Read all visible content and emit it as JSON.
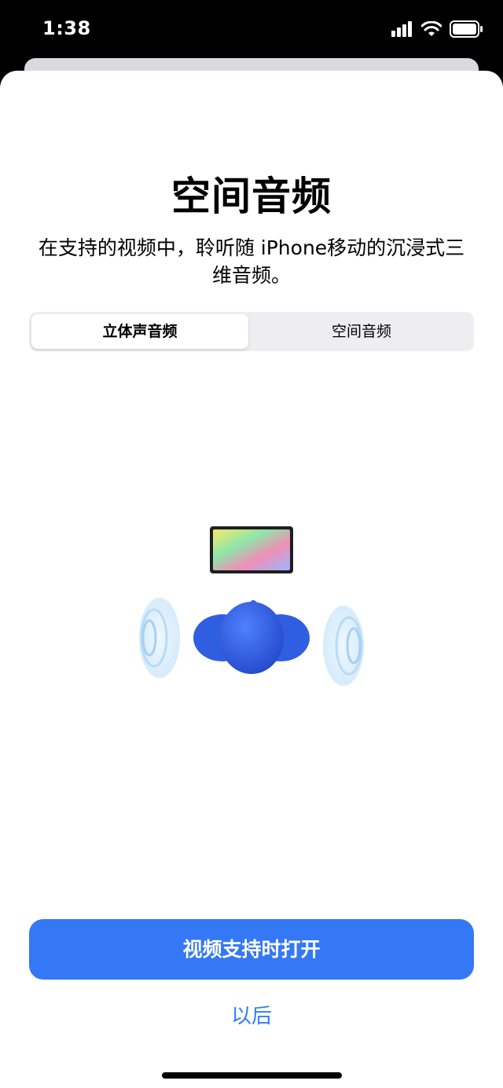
{
  "status_bar": {
    "time": "1:38",
    "icons": [
      "cellular-signal-icon",
      "wifi-icon",
      "battery-icon"
    ]
  },
  "sheet": {
    "title": "空间音频",
    "subtitle": "在支持的视频中，聆听随 iPhone移动的沉浸式三维音频。"
  },
  "segmented_control": {
    "options": [
      "立体声音频",
      "空间音频"
    ],
    "selected": "立体声音频"
  },
  "illustration": {
    "icons": [
      "screen-display-icon",
      "head-listener-icon",
      "sound-wave-left-icon",
      "sound-wave-right-icon"
    ]
  },
  "actions": {
    "primary": "视频支持时打开",
    "secondary": "以后"
  },
  "colors": {
    "accent": "#3478f6",
    "link": "#2f7ef6",
    "figure": "#2f5fe0"
  }
}
